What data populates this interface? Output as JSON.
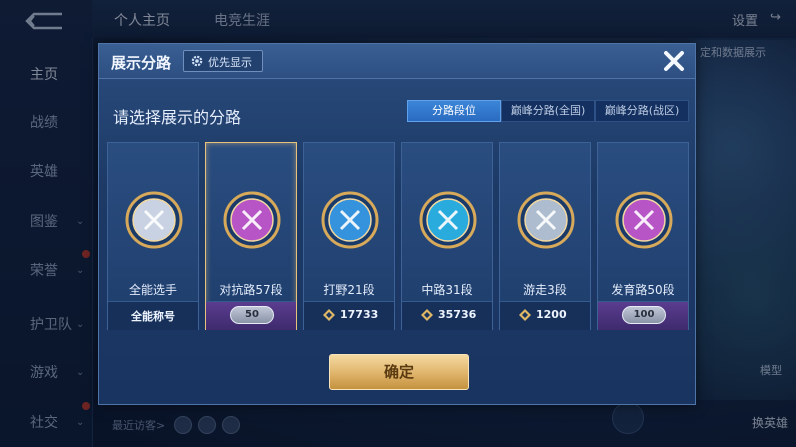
{
  "background": {
    "top_tabs": [
      "个人主页",
      "电竞生涯"
    ],
    "settings_label": "设置",
    "left_nav": [
      {
        "label": "主页",
        "has_chevron": false
      },
      {
        "label": "战绩",
        "has_chevron": false
      },
      {
        "label": "英雄",
        "has_chevron": false
      },
      {
        "label": "图鉴",
        "has_chevron": true
      },
      {
        "label": "荣誉",
        "has_chevron": true
      },
      {
        "label": "护卫队",
        "has_chevron": true
      },
      {
        "label": "游戏",
        "has_chevron": true
      },
      {
        "label": "社交",
        "has_chevron": true
      }
    ],
    "data_display_label": "定和数据展示",
    "recent_visitors_label": "最近访客>",
    "model_label": "模型",
    "swap_hero_label": "换英雄"
  },
  "modal": {
    "title": "展示分路",
    "priority_button_label": "优先显示",
    "subtitle": "请选择展示的分路",
    "segments": [
      {
        "label": "分路段位",
        "active": true
      },
      {
        "label": "巅峰分路(全国)",
        "active": false
      },
      {
        "label": "巅峰分路(战区)",
        "active": false
      }
    ],
    "cards": [
      {
        "label": "全能选手",
        "footer_type": "text",
        "footer": "全能称号",
        "selected": false,
        "medal": "all-round-medal-icon",
        "medal_color": "#e7edf8"
      },
      {
        "label": "对抗路57段",
        "footer_type": "star",
        "footer": "50",
        "selected": true,
        "medal": "clash-lane-medal-icon",
        "medal_color": "#d35bd6"
      },
      {
        "label": "打野21段",
        "footer_type": "score",
        "footer": "17733",
        "selected": false,
        "medal": "jungle-medal-icon",
        "medal_color": "#3aa3f0"
      },
      {
        "label": "中路31段",
        "footer_type": "score",
        "footer": "35736",
        "selected": false,
        "medal": "mid-lane-medal-icon",
        "medal_color": "#2ec0f2"
      },
      {
        "label": "游走3段",
        "footer_type": "score",
        "footer": "1200",
        "selected": false,
        "medal": "roam-medal-icon",
        "medal_color": "#c9d3e2"
      },
      {
        "label": "发育路50段",
        "footer_type": "star",
        "footer": "100",
        "selected": false,
        "medal": "farm-lane-medal-icon",
        "medal_color": "#d35bd6"
      }
    ],
    "confirm_label": "确定"
  }
}
